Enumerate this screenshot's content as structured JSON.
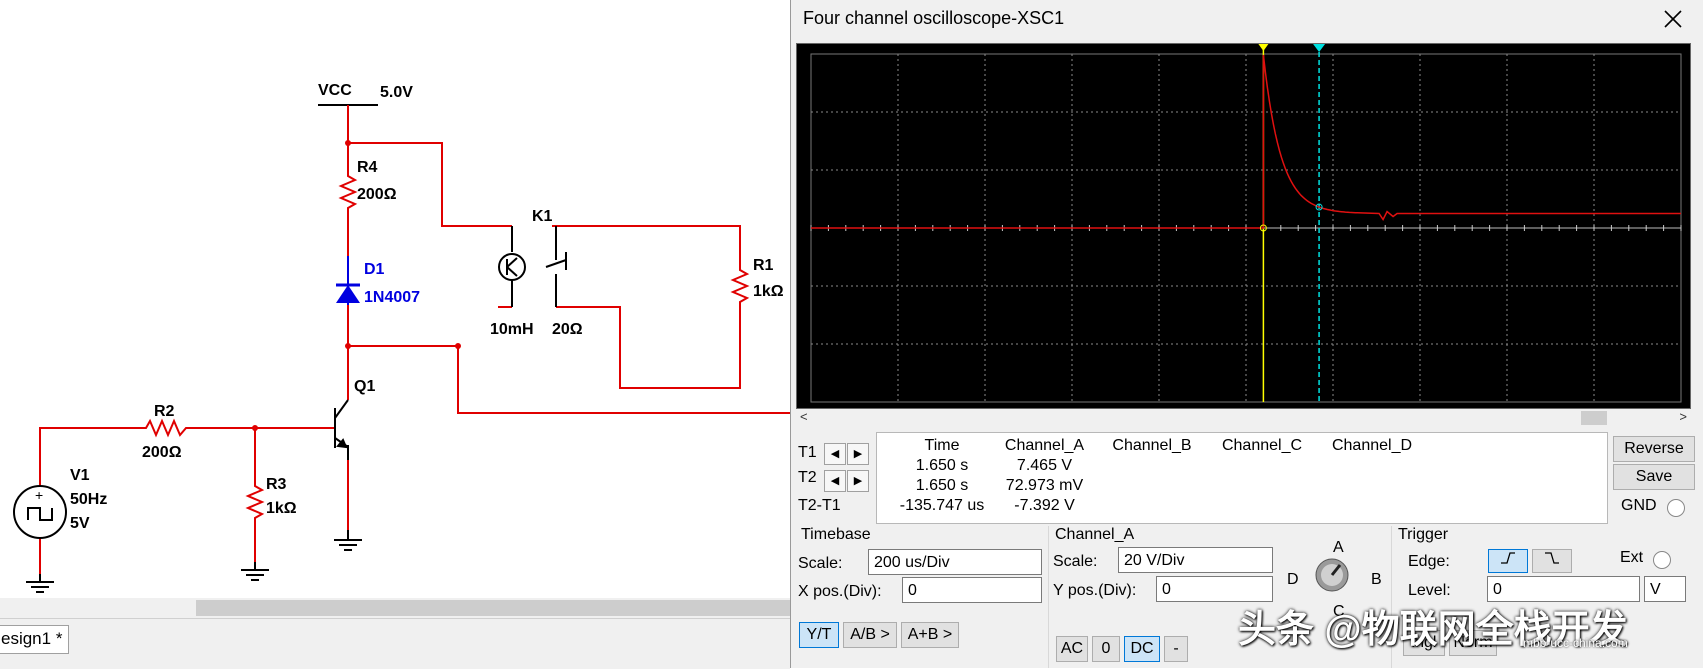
{
  "schematic": {
    "vcc_label": "VCC",
    "vcc_value": "5.0V",
    "r4_name": "R4",
    "r4_value": "200Ω",
    "d1_name": "D1",
    "d1_model": "1N4007",
    "k1_name": "K1",
    "k1_inductance": "10mH",
    "k1_resistance": "20Ω",
    "r1_name": "R1",
    "r1_value": "1kΩ",
    "q1_name": "Q1",
    "r2_name": "R2",
    "r2_value": "200Ω",
    "r3_name": "R3",
    "r3_value": "1kΩ",
    "v1_name": "V1",
    "v1_freq": "50Hz",
    "v1_amp": "5V",
    "wire_color": "#e00000",
    "diode_color": "#0000e0"
  },
  "design_tab": {
    "label": "esign1 *"
  },
  "oscilloscope": {
    "title": "Four channel oscilloscope-XSC1",
    "trace_color": "#e01010",
    "cursor1_color": "#ffff00",
    "cursor2_color": "#00e0e0",
    "cursors": {
      "t1_label": "T1",
      "t2_label": "T2",
      "diff_label": "T2-T1"
    },
    "readout": {
      "headers": [
        "Time",
        "Channel_A",
        "Channel_B",
        "Channel_C",
        "Channel_D"
      ],
      "rows": [
        [
          "1.650 s",
          "7.465 V",
          "",
          "",
          ""
        ],
        [
          "1.650 s",
          "72.973 mV",
          "",
          "",
          ""
        ],
        [
          "-135.747 us",
          "-7.392 V",
          "",
          "",
          ""
        ]
      ]
    },
    "buttons": {
      "reverse": "Reverse",
      "save": "Save",
      "gnd": "GND"
    },
    "timebase": {
      "title": "Timebase",
      "scale_label": "Scale:",
      "scale_value": "200 us/Div",
      "xpos_label": "X pos.(Div):",
      "xpos_value": "0",
      "modes": [
        "Y/T",
        "A/B >",
        "A+B >"
      ],
      "active_mode": "Y/T"
    },
    "channel": {
      "title": "Channel_A",
      "scale_label": "Scale:",
      "scale_value": "20  V/Div",
      "ypos_label": "Y pos.(Div):",
      "ypos_value": "0",
      "coupling": [
        "AC",
        "0",
        "DC",
        "-"
      ],
      "active_coupling": "DC",
      "knob_a": "A",
      "knob_b": "B",
      "knob_c": "C",
      "knob_d": "D"
    },
    "trigger": {
      "title": "Trigger",
      "edge_label": "Edge:",
      "ext_label": "Ext",
      "level_label": "Level:",
      "level_value": "0",
      "level_unit": "V",
      "mode_partial_1": "ingl",
      "mode_partial_2": "Norm"
    },
    "trace": {
      "t1_ch_a_volts": 7.465,
      "t2_ch_a_volts": 0.072973,
      "t2_minus_t1_us": -135.747,
      "settle_level_div": 0.25
    }
  },
  "watermark": {
    "text": "头条 @物联网全栈开发",
    "sub": "mbb-ucc-china.com"
  }
}
